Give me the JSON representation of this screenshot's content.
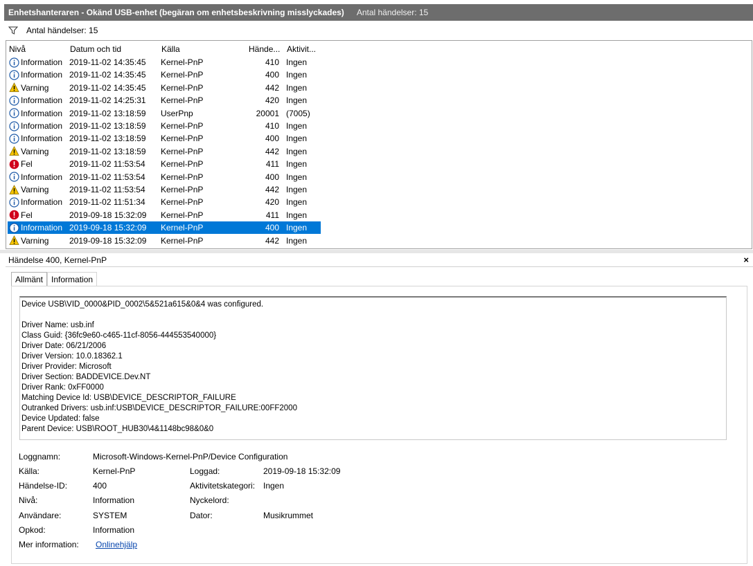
{
  "titlebar": {
    "title": "Enhetshanteraren - Okänd USB-enhet (begäran om enhetsbeskrivning misslyckades)",
    "count": "Antal händelser: 15"
  },
  "filterbar": {
    "icon": "filter-icon",
    "text": "Antal händelser: 15"
  },
  "columns": {
    "level": "Nivå",
    "date": "Datum och tid",
    "source": "Källa",
    "event_id": "Hände...",
    "task": "Aktivit..."
  },
  "events": [
    {
      "level": "Information",
      "icon": "info-icon",
      "date": "2019-11-02 14:35:45",
      "source": "Kernel-PnP",
      "event_id": "410",
      "task": "Ingen"
    },
    {
      "level": "Information",
      "icon": "info-icon",
      "date": "2019-11-02 14:35:45",
      "source": "Kernel-PnP",
      "event_id": "400",
      "task": "Ingen"
    },
    {
      "level": "Varning",
      "icon": "warning-icon",
      "date": "2019-11-02 14:35:45",
      "source": "Kernel-PnP",
      "event_id": "442",
      "task": "Ingen"
    },
    {
      "level": "Information",
      "icon": "info-icon",
      "date": "2019-11-02 14:25:31",
      "source": "Kernel-PnP",
      "event_id": "420",
      "task": "Ingen"
    },
    {
      "level": "Information",
      "icon": "info-icon",
      "date": "2019-11-02 13:18:59",
      "source": "UserPnp",
      "event_id": "20001",
      "task": "(7005)"
    },
    {
      "level": "Information",
      "icon": "info-icon",
      "date": "2019-11-02 13:18:59",
      "source": "Kernel-PnP",
      "event_id": "410",
      "task": "Ingen"
    },
    {
      "level": "Information",
      "icon": "info-icon",
      "date": "2019-11-02 13:18:59",
      "source": "Kernel-PnP",
      "event_id": "400",
      "task": "Ingen"
    },
    {
      "level": "Varning",
      "icon": "warning-icon",
      "date": "2019-11-02 13:18:59",
      "source": "Kernel-PnP",
      "event_id": "442",
      "task": "Ingen"
    },
    {
      "level": "Fel",
      "icon": "error-icon",
      "date": "2019-11-02 11:53:54",
      "source": "Kernel-PnP",
      "event_id": "411",
      "task": "Ingen"
    },
    {
      "level": "Information",
      "icon": "info-icon",
      "date": "2019-11-02 11:53:54",
      "source": "Kernel-PnP",
      "event_id": "400",
      "task": "Ingen"
    },
    {
      "level": "Varning",
      "icon": "warning-icon",
      "date": "2019-11-02 11:53:54",
      "source": "Kernel-PnP",
      "event_id": "442",
      "task": "Ingen"
    },
    {
      "level": "Information",
      "icon": "info-icon",
      "date": "2019-11-02 11:51:34",
      "source": "Kernel-PnP",
      "event_id": "420",
      "task": "Ingen"
    },
    {
      "level": "Fel",
      "icon": "error-icon",
      "date": "2019-09-18 15:32:09",
      "source": "Kernel-PnP",
      "event_id": "411",
      "task": "Ingen"
    },
    {
      "level": "Information",
      "icon": "info-icon",
      "date": "2019-09-18 15:32:09",
      "source": "Kernel-PnP",
      "event_id": "400",
      "task": "Ingen",
      "selected": true
    },
    {
      "level": "Varning",
      "icon": "warning-icon",
      "date": "2019-09-18 15:32:09",
      "source": "Kernel-PnP",
      "event_id": "442",
      "task": "Ingen"
    }
  ],
  "detail": {
    "header": "Händelse 400, Kernel-PnP",
    "close": "×",
    "tabs": [
      "Allmänt",
      "Information"
    ],
    "description": "Device USB\\VID_0000&PID_0002\\5&521a615&0&4 was configured.\n\nDriver Name: usb.inf\nClass Guid: {36fc9e60-c465-11cf-8056-444553540000}\nDriver Date: 06/21/2006\nDriver Version: 10.0.18362.1\nDriver Provider: Microsoft\nDriver Section: BADDEVICE.Dev.NT\nDriver Rank: 0xFF0000\nMatching Device Id: USB\\DEVICE_DESCRIPTOR_FAILURE\nOutranked Drivers: usb.inf:USB\\DEVICE_DESCRIPTOR_FAILURE:00FF2000\nDevice Updated: false\nParent Device: USB\\ROOT_HUB30\\4&1148bc98&0&0",
    "props": {
      "log_name_label": "Loggnamn:",
      "log_name": "Microsoft-Windows-Kernel-PnP/Device Configuration",
      "source_label": "Källa:",
      "source": "Kernel-PnP",
      "logged_label": "Loggad:",
      "logged": "2019-09-18 15:32:09",
      "event_id_label": "Händelse-ID:",
      "event_id": "400",
      "task_label": "Aktivitetskategori:",
      "task": "Ingen",
      "level_label": "Nivå:",
      "level": "Information",
      "keywords_label": "Nyckelord:",
      "keywords": "",
      "user_label": "Användare:",
      "user": "SYSTEM",
      "computer_label": "Dator:",
      "computer": "Musikrummet",
      "opcode_label": "Opkod:",
      "opcode": "Information",
      "more_info_label": "Mer information:",
      "more_info_link": "Onlinehjälp"
    }
  },
  "colors": {
    "titlebar": "#6d6d6d",
    "selection": "#0078d7",
    "info_icon": "#1e5aa8",
    "warning_icon": "#f5c400",
    "error_icon": "#d0021b",
    "link": "#0645ad"
  }
}
